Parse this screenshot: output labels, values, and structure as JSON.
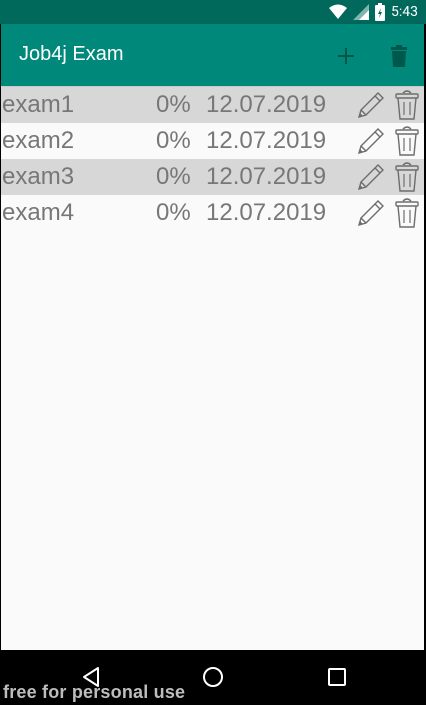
{
  "status_bar": {
    "time": "5:43",
    "icons": [
      "wifi-icon",
      "signal-icon",
      "battery-icon"
    ]
  },
  "app_bar": {
    "title": "Job4j Exam",
    "actions": [
      "add-icon",
      "delete-icon"
    ],
    "color": "#00897b"
  },
  "exams": [
    {
      "name": "exam1",
      "percent": "0%",
      "date": "12.07.2019"
    },
    {
      "name": "exam2",
      "percent": "0%",
      "date": "12.07.2019"
    },
    {
      "name": "exam3",
      "percent": "0%",
      "date": "12.07.2019"
    },
    {
      "name": "exam4",
      "percent": "0%",
      "date": "12.07.2019"
    }
  ],
  "row_icons": [
    "pencil-icon",
    "trash-icon"
  ],
  "nav_bar": {
    "buttons": [
      "back-icon",
      "home-icon",
      "recents-icon"
    ]
  },
  "watermark": "free for personal use"
}
